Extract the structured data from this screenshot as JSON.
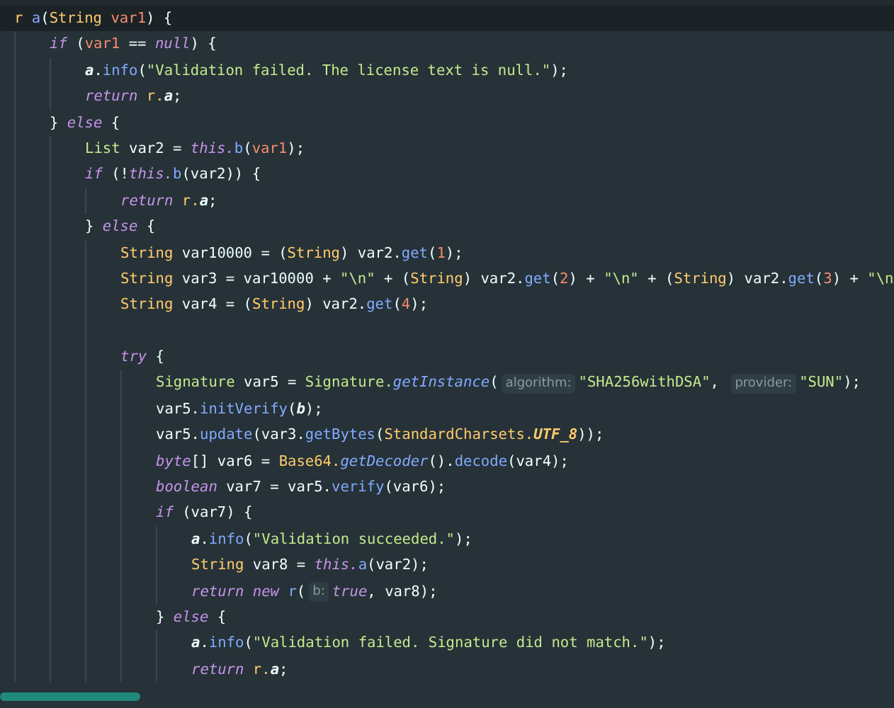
{
  "lines": [
    {
      "current": true,
      "tokens": [
        {
          "kind": "class",
          "text": "r "
        },
        {
          "kind": "method",
          "text": "a"
        },
        {
          "kind": "plain",
          "text": "("
        },
        {
          "kind": "class",
          "text": "String "
        },
        {
          "kind": "param",
          "text": "var1"
        },
        {
          "kind": "plain",
          "text": ") {"
        }
      ],
      "children": [
        {
          "current": false,
          "tokens": [
            {
              "kind": "keyword",
              "text": "if"
            },
            {
              "kind": "plain",
              "text": " ("
            },
            {
              "kind": "param",
              "text": "var1"
            },
            {
              "kind": "plain",
              "text": " == "
            },
            {
              "kind": "keyword",
              "text": "null"
            },
            {
              "kind": "plain",
              "text": ") {"
            }
          ],
          "children": [
            {
              "current": false,
              "tokens": [
                {
                  "kind": "field",
                  "text": "a"
                },
                {
                  "kind": "plain",
                  "text": "."
                },
                {
                  "kind": "method",
                  "text": "info"
                },
                {
                  "kind": "plain",
                  "text": "("
                },
                {
                  "kind": "string",
                  "text": "\"Validation failed. The license text is null.\""
                },
                {
                  "kind": "plain",
                  "text": ");"
                }
              ]
            },
            {
              "current": false,
              "tokens": [
                {
                  "kind": "keyword",
                  "text": "return "
                },
                {
                  "kind": "class",
                  "text": "r."
                },
                {
                  "kind": "field",
                  "text": "a"
                },
                {
                  "kind": "plain",
                  "text": ";"
                }
              ]
            }
          ]
        },
        {
          "current": false,
          "tokens": [
            {
              "kind": "plain",
              "text": "} "
            },
            {
              "kind": "keyword",
              "text": "else"
            },
            {
              "kind": "plain",
              "text": " {"
            }
          ],
          "children": [
            {
              "current": false,
              "tokens": [
                {
                  "kind": "iface",
                  "text": "List"
                },
                {
                  "kind": "plain",
                  "text": " var2 = "
                },
                {
                  "kind": "keyword",
                  "text": "this."
                },
                {
                  "kind": "method",
                  "text": "b"
                },
                {
                  "kind": "plain",
                  "text": "("
                },
                {
                  "kind": "param",
                  "text": "var1"
                },
                {
                  "kind": "plain",
                  "text": ");"
                }
              ]
            },
            {
              "current": false,
              "tokens": [
                {
                  "kind": "keyword",
                  "text": "if"
                },
                {
                  "kind": "plain",
                  "text": " (!"
                },
                {
                  "kind": "keyword",
                  "text": "this."
                },
                {
                  "kind": "method",
                  "text": "b"
                },
                {
                  "kind": "plain",
                  "text": "(var2)) {"
                }
              ],
              "children": [
                {
                  "current": false,
                  "tokens": [
                    {
                      "kind": "keyword",
                      "text": "return "
                    },
                    {
                      "kind": "class",
                      "text": "r."
                    },
                    {
                      "kind": "field",
                      "text": "a"
                    },
                    {
                      "kind": "plain",
                      "text": ";"
                    }
                  ]
                }
              ]
            },
            {
              "current": false,
              "tokens": [
                {
                  "kind": "plain",
                  "text": "} "
                },
                {
                  "kind": "keyword",
                  "text": "else"
                },
                {
                  "kind": "plain",
                  "text": " {"
                }
              ],
              "children": [
                {
                  "current": false,
                  "tokens": [
                    {
                      "kind": "class",
                      "text": "String"
                    },
                    {
                      "kind": "plain",
                      "text": " var10000 = ("
                    },
                    {
                      "kind": "class",
                      "text": "String"
                    },
                    {
                      "kind": "plain",
                      "text": ") var2."
                    },
                    {
                      "kind": "method",
                      "text": "get"
                    },
                    {
                      "kind": "plain",
                      "text": "("
                    },
                    {
                      "kind": "number",
                      "text": "1"
                    },
                    {
                      "kind": "plain",
                      "text": ");"
                    }
                  ]
                },
                {
                  "current": false,
                  "tokens": [
                    {
                      "kind": "class",
                      "text": "String"
                    },
                    {
                      "kind": "plain",
                      "text": " var3 = var10000 + "
                    },
                    {
                      "kind": "string",
                      "text": "\"\\n\""
                    },
                    {
                      "kind": "plain",
                      "text": " + ("
                    },
                    {
                      "kind": "class",
                      "text": "String"
                    },
                    {
                      "kind": "plain",
                      "text": ") var2."
                    },
                    {
                      "kind": "method",
                      "text": "get"
                    },
                    {
                      "kind": "plain",
                      "text": "("
                    },
                    {
                      "kind": "number",
                      "text": "2"
                    },
                    {
                      "kind": "plain",
                      "text": ") + "
                    },
                    {
                      "kind": "string",
                      "text": "\"\\n\""
                    },
                    {
                      "kind": "plain",
                      "text": " + ("
                    },
                    {
                      "kind": "class",
                      "text": "String"
                    },
                    {
                      "kind": "plain",
                      "text": ") var2."
                    },
                    {
                      "kind": "method",
                      "text": "get"
                    },
                    {
                      "kind": "plain",
                      "text": "("
                    },
                    {
                      "kind": "number",
                      "text": "3"
                    },
                    {
                      "kind": "plain",
                      "text": ") + "
                    },
                    {
                      "kind": "string",
                      "text": "\"\\n"
                    }
                  ]
                },
                {
                  "current": false,
                  "tokens": [
                    {
                      "kind": "class",
                      "text": "String"
                    },
                    {
                      "kind": "plain",
                      "text": " var4 = ("
                    },
                    {
                      "kind": "class",
                      "text": "String"
                    },
                    {
                      "kind": "plain",
                      "text": ") var2."
                    },
                    {
                      "kind": "method",
                      "text": "get"
                    },
                    {
                      "kind": "plain",
                      "text": "("
                    },
                    {
                      "kind": "number",
                      "text": "4"
                    },
                    {
                      "kind": "plain",
                      "text": ");"
                    }
                  ]
                },
                {
                  "current": false
                },
                {
                  "current": false,
                  "tokens": [
                    {
                      "kind": "keyword",
                      "text": "try"
                    },
                    {
                      "kind": "plain",
                      "text": " {"
                    }
                  ],
                  "children": [
                    {
                      "current": false,
                      "tokens": [
                        {
                          "kind": "iface",
                          "text": "Signature"
                        },
                        {
                          "kind": "plain",
                          "text": " var5 = "
                        },
                        {
                          "kind": "iface",
                          "text": "Signature."
                        },
                        {
                          "kind": "static",
                          "text": "getInstance"
                        },
                        {
                          "kind": "plain",
                          "text": "("
                        },
                        {
                          "kind": "hint",
                          "text": "algorithm:"
                        },
                        {
                          "kind": "string",
                          "text": "\"SHA256withDSA\""
                        },
                        {
                          "kind": "plain",
                          "text": ", "
                        },
                        {
                          "kind": "hint",
                          "text": "provider:"
                        },
                        {
                          "kind": "string",
                          "text": "\"SUN\""
                        },
                        {
                          "kind": "plain",
                          "text": ");"
                        }
                      ]
                    },
                    {
                      "current": false,
                      "tokens": [
                        {
                          "kind": "plain",
                          "text": "var5."
                        },
                        {
                          "kind": "method",
                          "text": "initVerify"
                        },
                        {
                          "kind": "plain",
                          "text": "("
                        },
                        {
                          "kind": "field",
                          "text": "b"
                        },
                        {
                          "kind": "plain",
                          "text": ");"
                        }
                      ]
                    },
                    {
                      "current": false,
                      "tokens": [
                        {
                          "kind": "plain",
                          "text": "var5."
                        },
                        {
                          "kind": "method",
                          "text": "update"
                        },
                        {
                          "kind": "plain",
                          "text": "(var3."
                        },
                        {
                          "kind": "method",
                          "text": "getBytes"
                        },
                        {
                          "kind": "plain",
                          "text": "("
                        },
                        {
                          "kind": "class",
                          "text": "StandardCharsets."
                        },
                        {
                          "kind": "constant",
                          "text": "UTF_8"
                        },
                        {
                          "kind": "plain",
                          "text": "));"
                        }
                      ]
                    },
                    {
                      "current": false,
                      "tokens": [
                        {
                          "kind": "keyword",
                          "text": "byte"
                        },
                        {
                          "kind": "plain",
                          "text": "[] var6 = "
                        },
                        {
                          "kind": "class",
                          "text": "Base64."
                        },
                        {
                          "kind": "static",
                          "text": "getDecoder"
                        },
                        {
                          "kind": "plain",
                          "text": "()."
                        },
                        {
                          "kind": "method",
                          "text": "decode"
                        },
                        {
                          "kind": "plain",
                          "text": "(var4);"
                        }
                      ]
                    },
                    {
                      "current": false,
                      "tokens": [
                        {
                          "kind": "keyword",
                          "text": "boolean"
                        },
                        {
                          "kind": "plain",
                          "text": " var7 = var5."
                        },
                        {
                          "kind": "method",
                          "text": "verify"
                        },
                        {
                          "kind": "plain",
                          "text": "(var6);"
                        }
                      ]
                    },
                    {
                      "current": false,
                      "tokens": [
                        {
                          "kind": "keyword",
                          "text": "if"
                        },
                        {
                          "kind": "plain",
                          "text": " (var7) {"
                        }
                      ],
                      "children": [
                        {
                          "current": false,
                          "tokens": [
                            {
                              "kind": "field",
                              "text": "a"
                            },
                            {
                              "kind": "plain",
                              "text": "."
                            },
                            {
                              "kind": "method",
                              "text": "info"
                            },
                            {
                              "kind": "plain",
                              "text": "("
                            },
                            {
                              "kind": "string",
                              "text": "\"Validation succeeded.\""
                            },
                            {
                              "kind": "plain",
                              "text": ");"
                            }
                          ]
                        },
                        {
                          "current": false,
                          "tokens": [
                            {
                              "kind": "class",
                              "text": "String"
                            },
                            {
                              "kind": "plain",
                              "text": " var8 = "
                            },
                            {
                              "kind": "keyword",
                              "text": "this."
                            },
                            {
                              "kind": "method",
                              "text": "a"
                            },
                            {
                              "kind": "plain",
                              "text": "(var2);"
                            }
                          ]
                        },
                        {
                          "current": false,
                          "tokens": [
                            {
                              "kind": "keyword",
                              "text": "return new "
                            },
                            {
                              "kind": "method",
                              "text": "r"
                            },
                            {
                              "kind": "plain",
                              "text": "("
                            },
                            {
                              "kind": "hint",
                              "text": "b:"
                            },
                            {
                              "kind": "keyword",
                              "text": "true"
                            },
                            {
                              "kind": "plain",
                              "text": ", var8);"
                            }
                          ]
                        }
                      ]
                    },
                    {
                      "current": false,
                      "tokens": [
                        {
                          "kind": "plain",
                          "text": "} "
                        },
                        {
                          "kind": "keyword",
                          "text": "else"
                        },
                        {
                          "kind": "plain",
                          "text": " {"
                        }
                      ],
                      "children": [
                        {
                          "current": false,
                          "tokens": [
                            {
                              "kind": "field",
                              "text": "a"
                            },
                            {
                              "kind": "plain",
                              "text": "."
                            },
                            {
                              "kind": "method",
                              "text": "info"
                            },
                            {
                              "kind": "plain",
                              "text": "("
                            },
                            {
                              "kind": "string",
                              "text": "\"Validation failed. Signature did not match.\""
                            },
                            {
                              "kind": "plain",
                              "text": ");"
                            }
                          ]
                        },
                        {
                          "current": false,
                          "tokens": [
                            {
                              "kind": "keyword",
                              "text": "return "
                            },
                            {
                              "kind": "class",
                              "text": "r."
                            },
                            {
                              "kind": "field",
                              "text": "a"
                            },
                            {
                              "kind": "plain",
                              "text": ";"
                            }
                          ]
                        }
                      ]
                    }
                  ]
                }
              ]
            }
          ]
        }
      ]
    }
  ]
}
